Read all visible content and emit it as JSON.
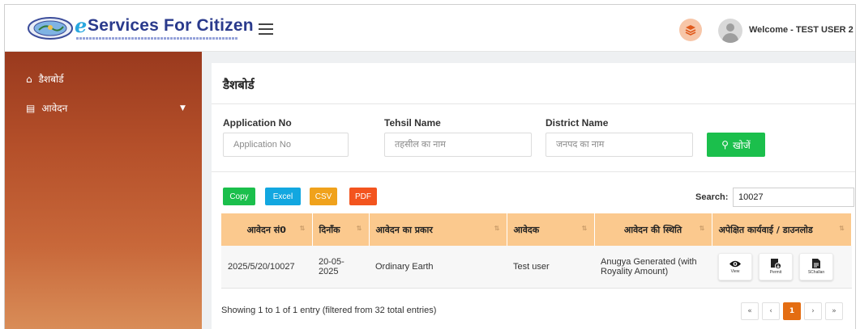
{
  "header": {
    "brand_e": "e",
    "brand_text": "Services For Citizen",
    "welcome": "Welcome - TEST USER 2",
    "icons": {
      "logo": "emblem-logo",
      "menu": "hamburger-icon",
      "layers": "layers-icon",
      "avatar": "user-avatar-icon"
    },
    "accent": "#2a3a8c"
  },
  "sidebar": {
    "items": [
      {
        "label": "डैशबोर्ड",
        "icon": "home-icon"
      },
      {
        "label": "आवेदन",
        "icon": "list-icon"
      }
    ]
  },
  "main": {
    "title": "डैशबोर्ड",
    "filters": {
      "application_no": {
        "label": "Application No",
        "placeholder": "Application No"
      },
      "tehsil": {
        "label": "Tehsil Name",
        "placeholder": "तहसील का नाम"
      },
      "district": {
        "label": "District Name",
        "placeholder": "जनपद का नाम"
      },
      "search_button": "खोजें"
    },
    "export_buttons": [
      {
        "label": "Copy",
        "color": "#1bbf4c"
      },
      {
        "label": "Excel",
        "color": "#12a7e0"
      },
      {
        "label": "CSV",
        "color": "#f0a21c"
      },
      {
        "label": "PDF",
        "color": "#f3541e"
      }
    ],
    "search": {
      "label": "Search:",
      "value": "10027"
    },
    "table": {
      "columns": [
        "आवेदन सं0",
        "दिनाँक",
        "आवेदन का प्रकार",
        "आवेदक",
        "आवेदन की स्थिति",
        "अपेक्षित कार्यवाई / डाउनलोड"
      ],
      "rows": [
        {
          "app_no": "2025/5/20/10027",
          "date": "20-05-2025",
          "type": "Ordinary Earth",
          "applicant": "Test user",
          "status": "Anugya Generated (with Royality Amount)",
          "actions": [
            {
              "label": "View",
              "icon": "eye-icon"
            },
            {
              "label": "Permit",
              "icon": "permit-download-icon"
            },
            {
              "label": "SChallan",
              "icon": "document-icon"
            }
          ]
        }
      ]
    },
    "info": "Showing 1 to 1 of 1 entry (filtered from 32 total entries)",
    "pagination": {
      "first": "«",
      "prev": "‹",
      "current": "1",
      "next": "›",
      "last": "»"
    }
  }
}
